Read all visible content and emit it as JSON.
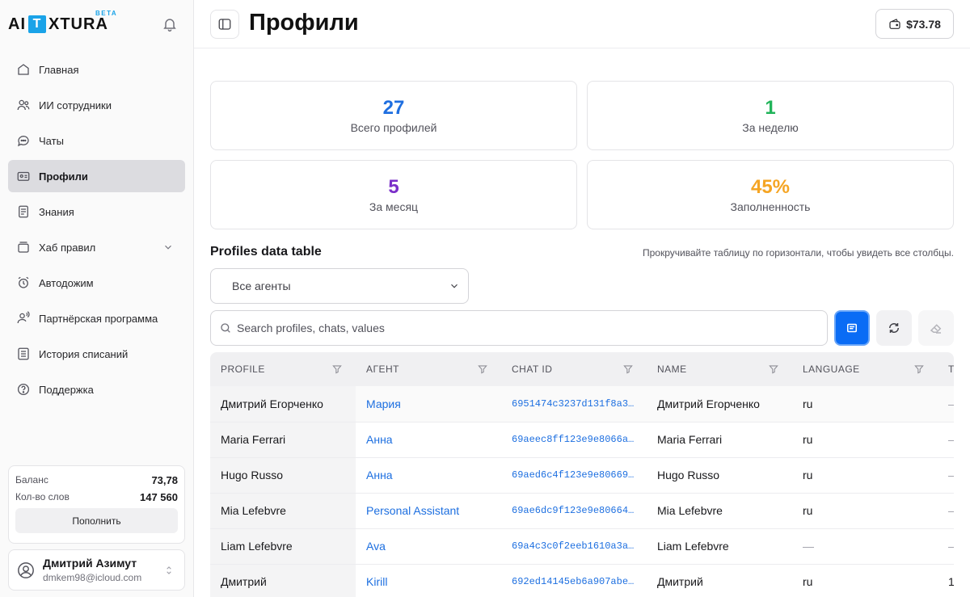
{
  "brand": {
    "left": "AI",
    "mid": "T",
    "right": "XTURA",
    "badge": "BETA"
  },
  "sidebar": {
    "items": [
      {
        "label": "Главная",
        "icon": "home-icon"
      },
      {
        "label": "ИИ сотрудники",
        "icon": "users-icon"
      },
      {
        "label": "Чаты",
        "icon": "chat-icon"
      },
      {
        "label": "Профили",
        "icon": "id-card-icon",
        "active": true
      },
      {
        "label": "Знания",
        "icon": "document-icon"
      },
      {
        "label": "Хаб правил",
        "icon": "stack-icon",
        "expandable": true
      },
      {
        "label": "Автодожим",
        "icon": "alarm-clock-icon"
      },
      {
        "label": "Партнёрская программа",
        "icon": "partner-icon"
      },
      {
        "label": "История списаний",
        "icon": "list-icon"
      },
      {
        "label": "Поддержка",
        "icon": "help-icon"
      }
    ],
    "balance": {
      "balance_label": "Баланс",
      "balance_value": "73,78",
      "words_label": "Кол-во слов",
      "words_value": "147 560",
      "topup_label": "Пополнить"
    },
    "user": {
      "name": "Дмитрий Азимут",
      "email": "dmkem98@icloud.com"
    }
  },
  "header": {
    "title": "Профили",
    "wallet": "$73.78"
  },
  "stats": [
    {
      "value": "27",
      "label": "Всего профилей",
      "color": "#1f6fe0"
    },
    {
      "value": "1",
      "label": "За неделю",
      "color": "#22b45a"
    },
    {
      "value": "5",
      "label": "За месяц",
      "color": "#7b2fc9"
    },
    {
      "value": "45%",
      "label": "Заполненность",
      "color": "#f5a524"
    }
  ],
  "table_section": {
    "title": "Profiles data table",
    "hint": "Прокручивайте таблицу по горизонтали, чтобы увидеть все столбцы.",
    "agent_filter": "Все агенты",
    "search_placeholder": "Search profiles, chats, values"
  },
  "table": {
    "columns": [
      "PROFILE",
      "АГЕНТ",
      "CHAT ID",
      "NAME",
      "LANGUAGE",
      "T"
    ],
    "rows": [
      {
        "profile": "Дмитрий Егорченко",
        "agent": "Мария",
        "chat_id": "6951474c3237d131f8a3…",
        "name": "Дмитрий Егорченко",
        "language": "ru",
        "extra": "–"
      },
      {
        "profile": "Maria Ferrari",
        "agent": "Анна",
        "chat_id": "69aeec8ff123e9e8066a…",
        "name": "Maria Ferrari",
        "language": "ru",
        "extra": "–"
      },
      {
        "profile": "Hugo Russo",
        "agent": "Анна",
        "chat_id": "69aed6c4f123e9e80669…",
        "name": "Hugo Russo",
        "language": "ru",
        "extra": "–"
      },
      {
        "profile": "Mia Lefebvre",
        "agent": "Personal Assistant",
        "chat_id": "69ae6dc9f123e9e80664…",
        "name": "Mia Lefebvre",
        "language": "ru",
        "extra": "–"
      },
      {
        "profile": "Liam Lefebvre",
        "agent": "Ava",
        "chat_id": "69a4c3c0f2eeb1610a3a…",
        "name": "Liam Lefebvre",
        "language": "—",
        "extra": "–"
      },
      {
        "profile": "Дмитрий",
        "agent": "Kirill",
        "chat_id": "692ed14145eb6a907abe…",
        "name": "Дмитрий",
        "language": "ru",
        "extra": "1"
      }
    ]
  }
}
